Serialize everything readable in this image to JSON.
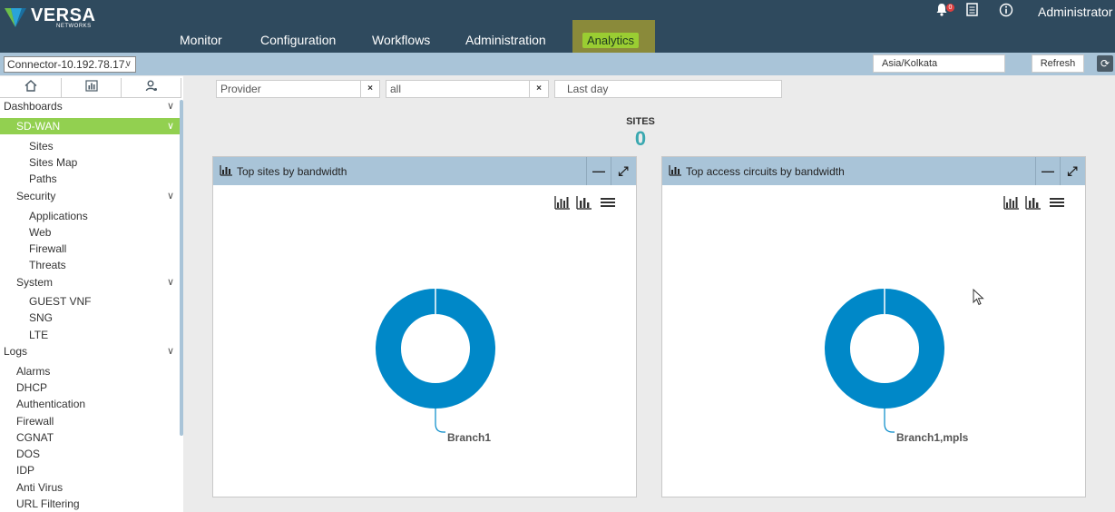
{
  "app": {
    "brand": "VERSA",
    "brand_sub": "NETWORKS",
    "notification_count": "0",
    "user": "Administrator"
  },
  "nav": {
    "items": [
      "Monitor",
      "Configuration",
      "Workflows",
      "Administration"
    ],
    "active": "Analytics"
  },
  "subbar": {
    "connector": "Connector-10.192.78.17.",
    "timezone": "Asia/Kolkata",
    "refresh_label": "Refresh"
  },
  "sidebar": {
    "items": [
      {
        "label": "Dashboards",
        "level": 0,
        "expandable": true
      },
      {
        "label": "SD-WAN",
        "level": 1,
        "expandable": true,
        "active": true
      },
      {
        "label": "Sites",
        "level": 2
      },
      {
        "label": "Sites Map",
        "level": 2
      },
      {
        "label": "Paths",
        "level": 2
      },
      {
        "label": "Security",
        "level": 1,
        "expandable": true
      },
      {
        "label": "Applications",
        "level": 2
      },
      {
        "label": "Web",
        "level": 2
      },
      {
        "label": "Firewall",
        "level": 2
      },
      {
        "label": "Threats",
        "level": 2
      },
      {
        "label": "System",
        "level": 1,
        "expandable": true
      },
      {
        "label": "GUEST VNF",
        "level": 2
      },
      {
        "label": "SNG",
        "level": 2
      },
      {
        "label": "LTE",
        "level": 2
      },
      {
        "label": "Logs",
        "level": 0,
        "expandable": true
      },
      {
        "label": "Alarms",
        "level": 1
      },
      {
        "label": "DHCP",
        "level": 1
      },
      {
        "label": "Authentication",
        "level": 1
      },
      {
        "label": "Firewall",
        "level": 1
      },
      {
        "label": "CGNAT",
        "level": 1
      },
      {
        "label": "DOS",
        "level": 1
      },
      {
        "label": "IDP",
        "level": 1
      },
      {
        "label": "Anti Virus",
        "level": 1
      },
      {
        "label": "URL Filtering",
        "level": 1
      }
    ]
  },
  "filters": {
    "provider_placeholder": "Provider",
    "scope_value": "all",
    "range_value": "Last day",
    "clear_symbol": "×"
  },
  "summary": {
    "sites_label": "SITES",
    "sites_value": "0"
  },
  "panels": [
    {
      "title": "Top sites by bandwidth",
      "slice_label": "Branch1"
    },
    {
      "title": "Top access circuits by bandwidth",
      "slice_label": "Branch1,mpls"
    }
  ],
  "colors": {
    "topbar": "#2f4a5e",
    "accent": "#92d050",
    "donut": "#0088c8",
    "panel_header": "#a9c4d8"
  }
}
